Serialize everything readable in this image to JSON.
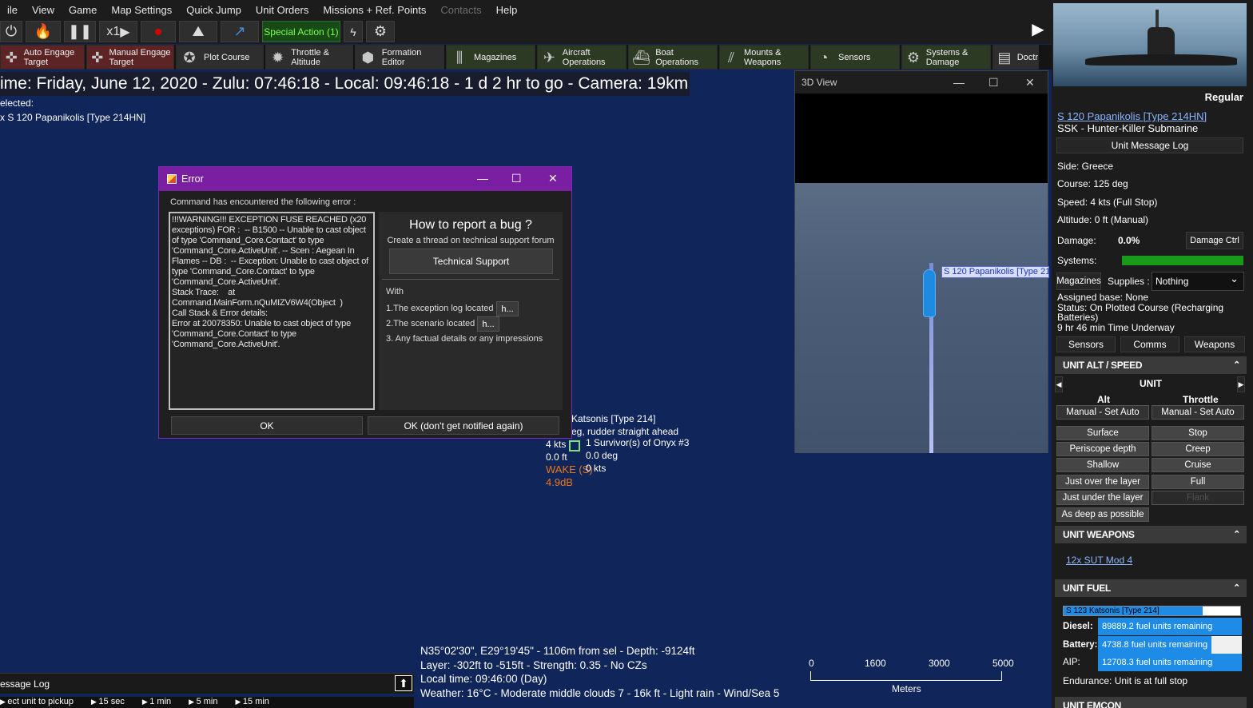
{
  "menu": {
    "items": [
      "ile",
      "View",
      "Game",
      "Map Settings",
      "Quick Jump",
      "Unit Orders",
      "Missions + Ref. Points",
      "Contacts",
      "Help"
    ]
  },
  "toolbar": {
    "speed_label": "x1",
    "special_action": "Special Action (1)"
  },
  "orders": [
    {
      "label": "Auto Engage Target",
      "icon": "crosshair-icon"
    },
    {
      "label": "Manual Engage Target",
      "icon": "crosshair-icon"
    },
    {
      "label": "Plot Course",
      "icon": "compass-icon"
    },
    {
      "label": "Throttle & Altitude",
      "icon": "gear-icon"
    },
    {
      "label": "Formation Editor",
      "icon": "hex-icon"
    },
    {
      "label": "Magazines",
      "icon": "ammo-icon"
    },
    {
      "label": "Aircraft Operations",
      "icon": "aircraft-icon"
    },
    {
      "label": "Boat Operations",
      "icon": "boat-icon"
    },
    {
      "label": "Mounts & Weapons",
      "icon": "missile-icon"
    },
    {
      "label": "Sensors",
      "icon": "radar-icon"
    },
    {
      "label": "Systems & Damage",
      "icon": "gear-icon"
    },
    {
      "label": "Doctr",
      "icon": "document-icon"
    }
  ],
  "status": {
    "time_line": "ime: Friday, June 12, 2020 - Zulu: 07:46:18 - Local: 09:46:18 - 1 d 2 hr to go - Camera: 19km",
    "selected_label": "elected:",
    "selected_unit": "x S 120 Papanikolis [Type 214HN]"
  },
  "map": {
    "contact_name": "Katsonis [Type 214]",
    "contact_order": "eg, rudder straight ahead",
    "contact_speed": "4 kts",
    "contact_alt": "0.0 ft",
    "contact_wake": "WAKE (S)",
    "contact_db": "4.9dB",
    "survivor": "1 Survivor(s) of Onyx #3",
    "survivor_course": "0.0 deg",
    "survivor_speed": "0 kts"
  },
  "bottom": {
    "line1": "N35°02'30\", E29°19'45\" - 1106m from sel - Depth: -9124ft",
    "line2": "Layer: -302ft to -515ft - Strength: 0.35 - No CZs",
    "line3": "Local time: 09:46:00 (Day)",
    "line4": "Weather: 16°C - Moderate middle clouds 7 - 16k ft - Light rain - Wind/Sea 5",
    "message_log": "essage Log",
    "timebar": [
      "ect unit to pickup",
      "15 sec",
      "1 min",
      "5 min",
      "15 min"
    ]
  },
  "scale": {
    "ticks": [
      "0",
      "1600",
      "3000",
      "5000"
    ],
    "unit": "Meters"
  },
  "view3d": {
    "title": "3D View",
    "unit_label": "S 120 Papanikolis [Type 214HN]"
  },
  "unit_panel": {
    "proficiency": "Regular",
    "name": "S 120 Papanikolis [Type 214HN]",
    "type": "SSK - Hunter-Killer Submarine",
    "message_log_btn": "Unit Message Log",
    "side": "Side: Greece",
    "course": "Course: 125 deg",
    "speed": "Speed: 4 kts (Full Stop)",
    "altitude": "Altitude: 0 ft (Manual)",
    "damage_label": "Damage:",
    "damage_value": "0.0%",
    "damage_btn": "Damage Ctrl",
    "systems_label": "Systems:",
    "magazines_btn": "Magazines",
    "supplies_label": "Supplies :",
    "supplies_value": "Nothing",
    "assigned_base": "Assigned base: None",
    "status_line1": "Status: On Plotted Course (Recharging",
    "status_line2": "Batteries)",
    "underway": "9 hr 46 min Time Underway",
    "tabs": [
      "Sensors",
      "Comms",
      "Weapons"
    ]
  },
  "alt_speed": {
    "header": "UNIT ALT / SPEED",
    "selector": "UNIT",
    "alt_col": "Alt",
    "throttle_col": "Throttle",
    "manual_alt": "Manual - Set Auto",
    "manual_throttle": "Manual - Set Auto",
    "depths": [
      "Surface",
      "Periscope depth",
      "Shallow",
      "Just over the layer",
      "Just under the layer",
      "As deep as possible"
    ],
    "throttles": [
      "Stop",
      "Creep",
      "Cruise",
      "Full",
      "Flank"
    ]
  },
  "weapons": {
    "header": "UNIT WEAPONS",
    "item": "12x SUT Mod 4"
  },
  "fuel": {
    "header": "UNIT FUEL",
    "selected_unit": "S 123 Katsonis [Type 214]",
    "rows": [
      {
        "label": "Diesel:",
        "value": "89889.2 fuel units remaining",
        "fraction": 1.0
      },
      {
        "label": "Battery:",
        "value": "4738.8 fuel units remaining",
        "fraction": 0.79
      },
      {
        "label": "AIP:",
        "value": "12708.3 fuel units remaining",
        "fraction": 1.0
      }
    ],
    "endurance": "Endurance: Unit is at full stop"
  },
  "emcon": {
    "header": "UNIT EMCON"
  },
  "error_dialog": {
    "title": "Error",
    "intro": "Command has encountered the following error :",
    "message": "!!!WARNING!!! EXCEPTION FUSE REACHED (x20 exceptions) FOR :  -- B1500 -- Unable to cast object of type 'Command_Core.Contact' to type 'Command_Core.ActiveUnit'. -- Scen : Aegean In Flames -- DB :  -- Exception: Unable to cast object of type 'Command_Core.Contact' to type 'Command_Core.ActiveUnit'.\nStack Trace:    at Command.MainForm.nQuMIZV6W4(Object  )\nCall Stack & Error details:\nError at 20078350: Unable to cast object of type 'Command_Core.Contact' to type 'Command_Core.ActiveUnit'.",
    "report_heading": "How to report a bug ?",
    "report_sub": "Create a thread on technical support forum",
    "support_btn": "Technical Support",
    "with": "With",
    "step1": "1.The exception log located",
    "step2": "2.The scenario located",
    "step3": "3. Any factual details or any impressions",
    "h_btn": "h...",
    "ok": "OK",
    "ok_no_notify": "OK (don't get notified again)"
  }
}
